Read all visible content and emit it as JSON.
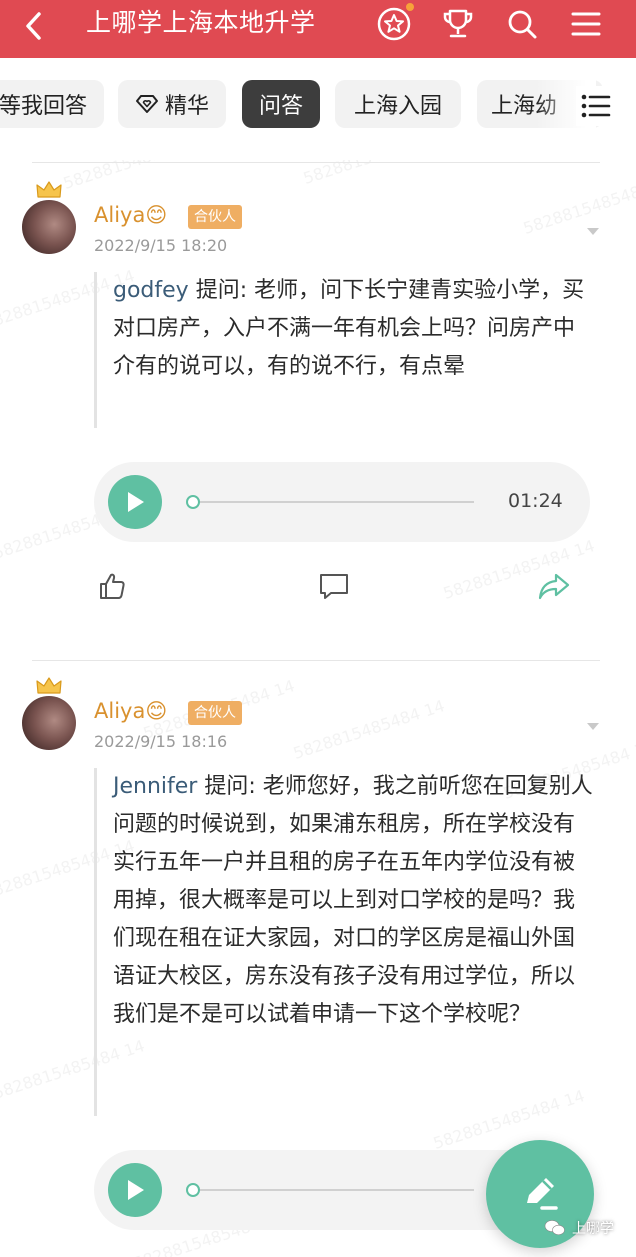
{
  "header": {
    "title": "上哪学上海本地升学",
    "icons": [
      "back-icon",
      "star-badge-icon",
      "trophy-icon",
      "search-icon",
      "hamburger-menu-icon"
    ],
    "bg_color": "#e04a52"
  },
  "tabs": [
    {
      "label": "等我回答",
      "active": false
    },
    {
      "label": "精华",
      "active": false,
      "icon": "diamond-heart-icon"
    },
    {
      "label": "问答",
      "active": true
    },
    {
      "label": "上海入园",
      "active": false
    },
    {
      "label": "上海幼",
      "active": false
    }
  ],
  "posts": [
    {
      "user": "Aliya😊",
      "role": "合伙人",
      "time": "2022/9/15 18:20",
      "asker": "godfey",
      "ask_label": "提问:",
      "question": "老师，问下长宁建青实验小学，买对口房产，入户不满一年有机会上吗？问房产中介有的说可以，有的说不行，有点晕",
      "audio_duration": "01:24"
    },
    {
      "user": "Aliya😊",
      "role": "合伙人",
      "time": "2022/9/15 18:16",
      "asker": "Jennifer",
      "ask_label": "提问:",
      "question": "老师您好，我之前听您在回复别人问题的时候说到，如果浦东租房，所在学校没有实行五年一户并且租的房子在五年内学位没有被用掉，很大概率是可以上到对口学校的是吗？我们现在租在证大家园，对口的学区房是福山外国语证大校区，房东没有孩子没有用过学位，所以我们是不是可以试着申请一下这个学校呢？"
    }
  ],
  "watermark_text": "5828815485484 14",
  "source_mark": "上哪学",
  "accent_color": "#5fc0a2"
}
